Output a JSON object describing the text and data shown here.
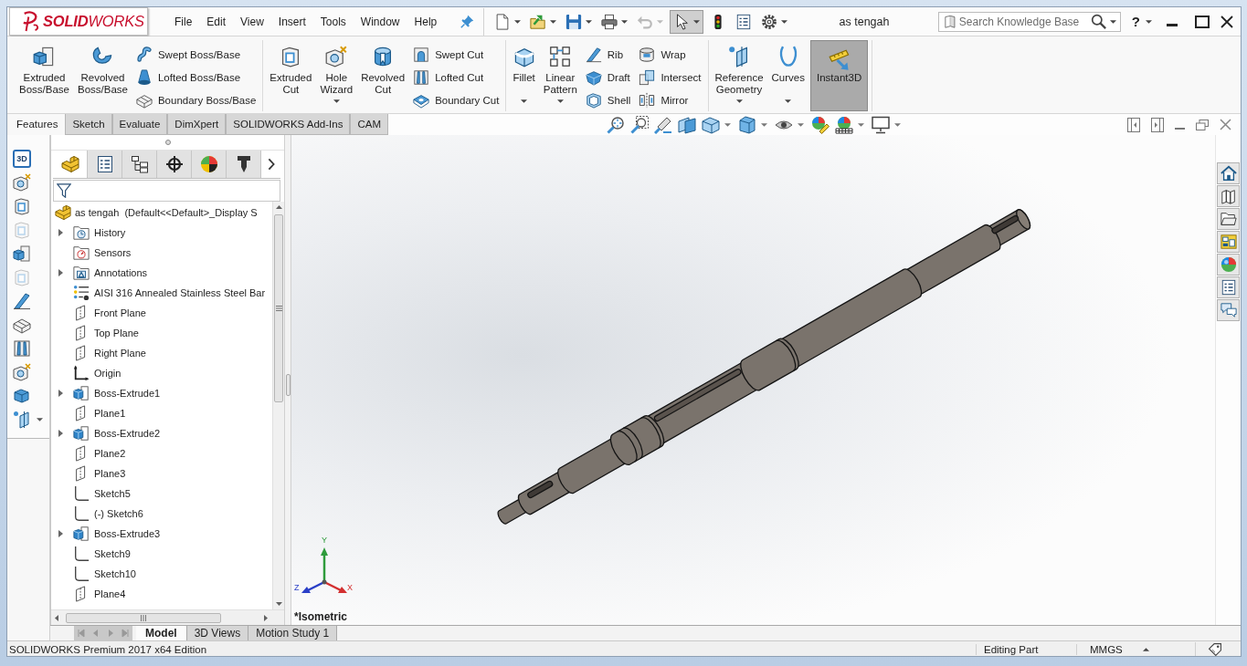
{
  "window": {
    "logo": "**SOLID**WORKS",
    "title": "as tengah",
    "help": "?"
  },
  "menu": [
    "File",
    "Edit",
    "View",
    "Insert",
    "Tools",
    "Window",
    "Help"
  ],
  "quick_access": [
    {
      "dropdown": true,
      "disabled": false,
      "pressed": false
    },
    {
      "dropdown": true,
      "disabled": false,
      "pressed": false
    },
    {
      "dropdown": true,
      "disabled": false,
      "pressed": false
    },
    {
      "dropdown": true,
      "disabled": false,
      "pressed": false
    },
    {
      "dropdown": true,
      "disabled": true,
      "pressed": false
    },
    {
      "dropdown": true,
      "disabled": false,
      "pressed": true
    },
    {
      "dropdown": false,
      "disabled": false,
      "pressed": false
    },
    {
      "dropdown": false,
      "disabled": false,
      "pressed": false
    },
    {
      "dropdown": true,
      "disabled": false,
      "pressed": false
    }
  ],
  "search": {
    "placeholder": "Search Knowledge Base"
  },
  "ribbon": [
    {
      "items": [
        {
          "kind": "large",
          "label": "Extruded Boss/Base",
          "dropdown": false,
          "pressed": false
        },
        {
          "kind": "large",
          "label": "Revolved Boss/Base",
          "dropdown": false,
          "pressed": false
        },
        {
          "kind": "column",
          "buttons": [
            "Swept Boss/Base",
            "Lofted Boss/Base",
            "Boundary Boss/Base"
          ]
        }
      ]
    },
    {
      "items": [
        {
          "kind": "large",
          "label": "Extruded Cut",
          "dropdown": false,
          "pressed": false
        },
        {
          "kind": "large",
          "label": "Hole Wizard",
          "dropdown": true,
          "pressed": false
        },
        {
          "kind": "large",
          "label": "Revolved Cut",
          "dropdown": false,
          "pressed": false
        },
        {
          "kind": "column",
          "buttons": [
            "Swept Cut",
            "Lofted Cut",
            "Boundary Cut"
          ]
        }
      ]
    },
    {
      "items": [
        {
          "kind": "large",
          "label": "Fillet",
          "dropdown": true,
          "pressed": false
        },
        {
          "kind": "large",
          "label": "Linear Pattern",
          "dropdown": true,
          "pressed": false
        },
        {
          "kind": "column",
          "buttons": [
            "Rib",
            "Draft",
            "Shell"
          ]
        },
        {
          "kind": "column",
          "buttons": [
            "Wrap",
            "Intersect",
            "Mirror"
          ]
        }
      ]
    },
    {
      "items": [
        {
          "kind": "large",
          "label": "Reference Geometry",
          "dropdown": true,
          "pressed": false
        },
        {
          "kind": "large",
          "label": "Curves",
          "dropdown": true,
          "pressed": false
        },
        {
          "kind": "large",
          "label": "Instant3D",
          "dropdown": false,
          "pressed": true
        }
      ]
    }
  ],
  "command_tabs": [
    {
      "label": "Features",
      "selected": true
    },
    {
      "label": "Sketch",
      "selected": false
    },
    {
      "label": "Evaluate",
      "selected": false
    },
    {
      "label": "DimXpert",
      "selected": false
    },
    {
      "label": "SOLIDWORKS Add-Ins",
      "selected": false
    },
    {
      "label": "CAM",
      "selected": false
    }
  ],
  "left_toolbar": [
    {
      "kind": "text",
      "label": "3D",
      "disabled": false,
      "dropdown": false
    },
    {
      "kind": "icon",
      "disabled": false,
      "dropdown": false
    },
    {
      "kind": "icon",
      "disabled": false,
      "dropdown": false
    },
    {
      "kind": "icon",
      "disabled": true,
      "dropdown": false
    },
    {
      "kind": "icon",
      "disabled": false,
      "dropdown": false
    },
    {
      "kind": "icon",
      "disabled": true,
      "dropdown": false
    },
    {
      "kind": "icon",
      "disabled": false,
      "dropdown": false
    },
    {
      "kind": "icon",
      "disabled": false,
      "dropdown": false
    },
    {
      "kind": "icon",
      "disabled": false,
      "dropdown": false
    },
    {
      "kind": "icon",
      "disabled": false,
      "dropdown": false
    },
    {
      "kind": "icon",
      "disabled": false,
      "dropdown": false
    },
    {
      "kind": "icon",
      "disabled": false,
      "dropdown": true
    }
  ],
  "feature_manager": {
    "tabs": [
      {
        "selected": true
      },
      {
        "selected": false
      },
      {
        "selected": false
      },
      {
        "selected": false
      },
      {
        "selected": false
      },
      {
        "selected": false
      }
    ],
    "tree": {
      "label": "as tengah  (Default<<Default>_Display S",
      "children": [
        {
          "label": "History",
          "kind": "history",
          "expanded": false
        },
        {
          "label": "Sensors",
          "kind": "sensors"
        },
        {
          "label": "Annotations",
          "kind": "annotations",
          "expanded": false
        },
        {
          "label": "AISI 316 Annealed Stainless Steel Bar",
          "kind": "material"
        },
        {
          "label": "Front Plane",
          "kind": "plane"
        },
        {
          "label": "Top Plane",
          "kind": "plane"
        },
        {
          "label": "Right Plane",
          "kind": "plane"
        },
        {
          "label": "Origin",
          "kind": "origin"
        },
        {
          "label": "Boss-Extrude1",
          "kind": "feature",
          "expanded": false
        },
        {
          "label": "Plane1",
          "kind": "plane"
        },
        {
          "label": "Boss-Extrude2",
          "kind": "feature",
          "expanded": false
        },
        {
          "label": "Plane2",
          "kind": "plane"
        },
        {
          "label": "Plane3",
          "kind": "plane"
        },
        {
          "label": "Sketch5",
          "kind": "sketch"
        },
        {
          "label": "(-) Sketch6",
          "kind": "sketch"
        },
        {
          "label": "Boss-Extrude3",
          "kind": "feature",
          "expanded": false
        },
        {
          "label": "Sketch9",
          "kind": "sketch"
        },
        {
          "label": "Sketch10",
          "kind": "sketch"
        },
        {
          "label": "Plane4",
          "kind": "plane"
        }
      ]
    }
  },
  "viewport": {
    "view_label": "*Isometric",
    "triad": {
      "x": "X",
      "y": "Y",
      "z": "Z"
    }
  },
  "bottom_tabs": [
    {
      "label": "Model",
      "selected": true
    },
    {
      "label": "3D Views",
      "selected": false
    },
    {
      "label": "Motion Study 1",
      "selected": false
    }
  ],
  "status_bar": {
    "product": "SOLIDWORKS Premium 2017 x64 Edition",
    "mode": "Editing Part",
    "units": "MMGS"
  }
}
